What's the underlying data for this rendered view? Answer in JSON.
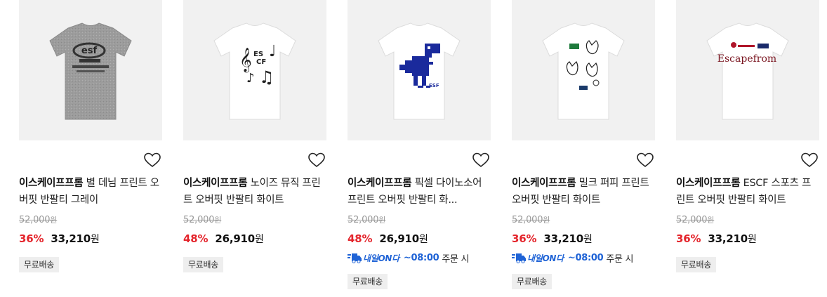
{
  "products": [
    {
      "brand": "이스케이프프롬",
      "name": "별 데님 프린트 오버핏 반팔티 그레이",
      "original_price": "52,000",
      "original_unit": "원",
      "discount_rate": "36%",
      "sale_price": "33,210",
      "sale_unit": "원",
      "badge": "무료배송",
      "delivery": null,
      "shirt_color": "#9c9c9c"
    },
    {
      "brand": "이스케이프프롬",
      "name": "노이즈 뮤직 프린트 오버핏 반팔티 화이트",
      "original_price": "52,000",
      "original_unit": "원",
      "discount_rate": "48%",
      "sale_price": "26,910",
      "sale_unit": "원",
      "badge": "무료배송",
      "delivery": null,
      "print_text": "ES\nCF",
      "shirt_color": "#ffffff"
    },
    {
      "brand": "이스케이프프롬",
      "name": "픽셀 다이노소어 프린트 오버핏 반팔티 화...",
      "original_price": "52,000",
      "original_unit": "원",
      "discount_rate": "48%",
      "sale_price": "26,910",
      "sale_unit": "원",
      "badge": "무료배송",
      "delivery": {
        "name": "내일ON다",
        "time": "~08:00",
        "text": "주문 시"
      },
      "shirt_color": "#ffffff"
    },
    {
      "brand": "이스케이프프롬",
      "name": "밀크 퍼피 프린트 오버핏 반팔티 화이트",
      "original_price": "52,000",
      "original_unit": "원",
      "discount_rate": "36%",
      "sale_price": "33,210",
      "sale_unit": "원",
      "badge": "무료배송",
      "delivery": {
        "name": "내일ON다",
        "time": "~08:00",
        "text": "주문 시"
      },
      "shirt_color": "#ffffff"
    },
    {
      "brand": "이스케이프프롬",
      "name": "ESCF 스포츠 프린트 오버핏 반팔티 화이트",
      "original_price": "52,000",
      "original_unit": "원",
      "discount_rate": "36%",
      "sale_price": "33,210",
      "sale_unit": "원",
      "badge": "무료배송",
      "delivery": null,
      "print_text": "Escapefrom",
      "shirt_color": "#ffffff"
    }
  ],
  "colors": {
    "discount": "#e4252c",
    "delivery": "#1f63d6",
    "original_price": "#9a9a9a",
    "badge_bg": "#eeeeee"
  },
  "icons": {
    "wishlist": "heart-outline-icon",
    "delivery": "fast-delivery-truck-icon"
  }
}
